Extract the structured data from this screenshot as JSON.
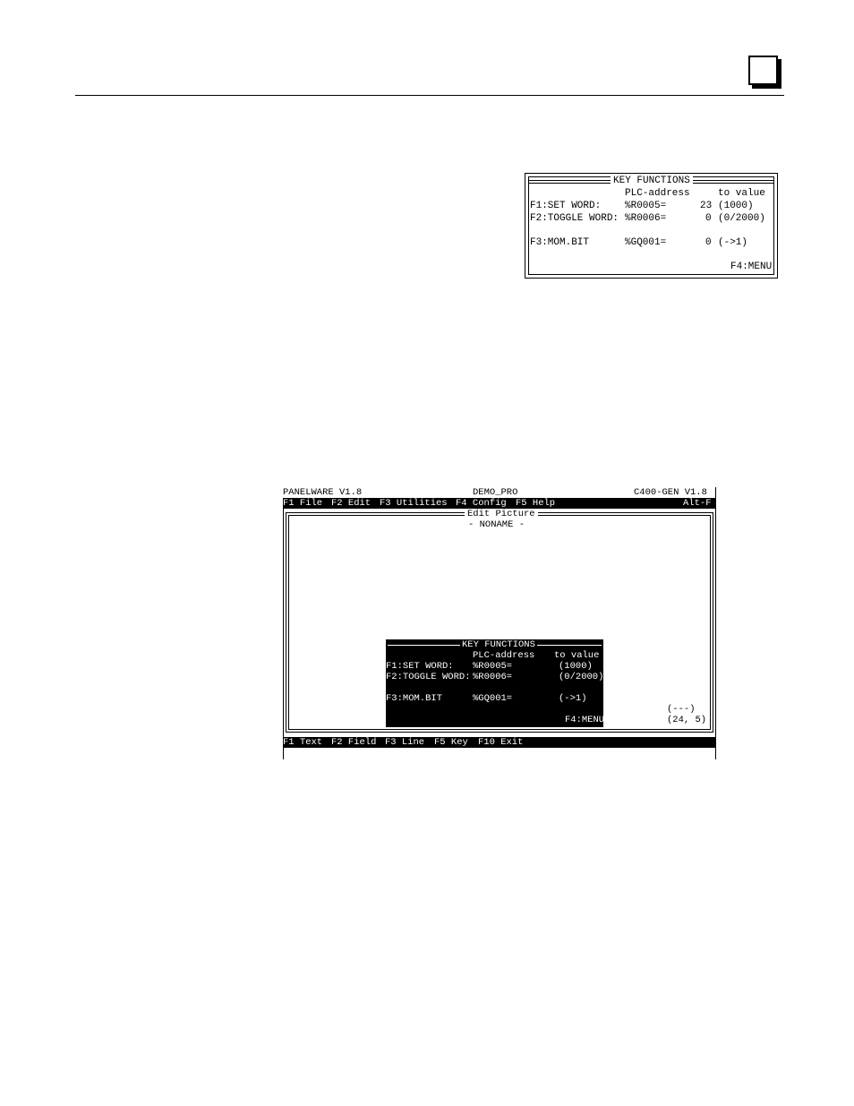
{
  "key_functions": {
    "title": "KEY FUNCTIONS",
    "col_address": "PLC-address",
    "col_value": "to value",
    "rows": [
      {
        "label": "F1:SET WORD:",
        "address": "%R0005=",
        "current": "23",
        "range": "(1000)"
      },
      {
        "label": "F2:TOGGLE WORD:",
        "address": "%R0006=",
        "current": "0",
        "range": "(0/2000)"
      },
      {
        "label": "F3:MOM.BIT",
        "address": "%GQ001=",
        "current": "0",
        "range": "(->1)"
      }
    ],
    "menu": "F4:MENU"
  },
  "terminal": {
    "app": "PANELWARE V1.8",
    "project": "DEMO_PRO",
    "target": "C400-GEN V1.8",
    "menubar": [
      "F1 File",
      "F2 Edit",
      "F3 Utilities",
      "F4 Config",
      "F5 Help"
    ],
    "menubar_right": "Alt-F",
    "frame_title": "Edit Picture",
    "frame_subtitle": "- NONAME -",
    "panel": {
      "title": "KEY FUNCTIONS",
      "col_address": "PLC-address",
      "col_value": "to value",
      "rows": [
        {
          "label": "F1:SET WORD:",
          "address": "%R0005=",
          "range": "(1000)"
        },
        {
          "label": "F2:TOGGLE WORD:",
          "address": "%R0006=",
          "range": "(0/2000)"
        },
        {
          "label": "F3:MOM.BIT",
          "address": "%GQ001=",
          "range": "(->1)"
        }
      ],
      "menu": "F4:MENU"
    },
    "cursor_mode": "(---)",
    "cursor_pos": "(24, 5)",
    "bottombar": [
      "F1 Text",
      "F2 Field",
      "F3 Line",
      "F5 Key",
      "F10 Exit"
    ]
  }
}
